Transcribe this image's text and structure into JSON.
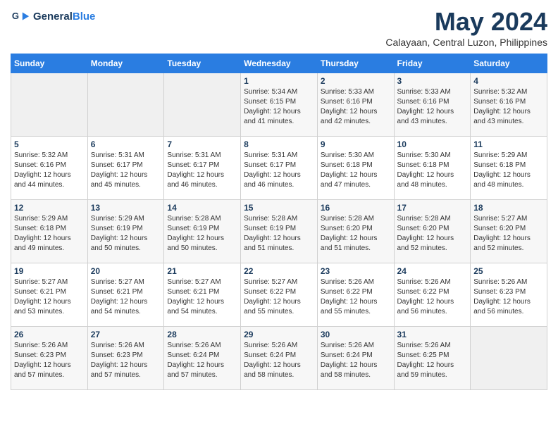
{
  "header": {
    "logo_line1": "General",
    "logo_line2": "Blue",
    "month_title": "May 2024",
    "location": "Calayaan, Central Luzon, Philippines"
  },
  "weekdays": [
    "Sunday",
    "Monday",
    "Tuesday",
    "Wednesday",
    "Thursday",
    "Friday",
    "Saturday"
  ],
  "weeks": [
    [
      {
        "day": "",
        "info": ""
      },
      {
        "day": "",
        "info": ""
      },
      {
        "day": "",
        "info": ""
      },
      {
        "day": "1",
        "info": "Sunrise: 5:34 AM\nSunset: 6:15 PM\nDaylight: 12 hours\nand 41 minutes."
      },
      {
        "day": "2",
        "info": "Sunrise: 5:33 AM\nSunset: 6:16 PM\nDaylight: 12 hours\nand 42 minutes."
      },
      {
        "day": "3",
        "info": "Sunrise: 5:33 AM\nSunset: 6:16 PM\nDaylight: 12 hours\nand 43 minutes."
      },
      {
        "day": "4",
        "info": "Sunrise: 5:32 AM\nSunset: 6:16 PM\nDaylight: 12 hours\nand 43 minutes."
      }
    ],
    [
      {
        "day": "5",
        "info": "Sunrise: 5:32 AM\nSunset: 6:16 PM\nDaylight: 12 hours\nand 44 minutes."
      },
      {
        "day": "6",
        "info": "Sunrise: 5:31 AM\nSunset: 6:17 PM\nDaylight: 12 hours\nand 45 minutes."
      },
      {
        "day": "7",
        "info": "Sunrise: 5:31 AM\nSunset: 6:17 PM\nDaylight: 12 hours\nand 46 minutes."
      },
      {
        "day": "8",
        "info": "Sunrise: 5:31 AM\nSunset: 6:17 PM\nDaylight: 12 hours\nand 46 minutes."
      },
      {
        "day": "9",
        "info": "Sunrise: 5:30 AM\nSunset: 6:18 PM\nDaylight: 12 hours\nand 47 minutes."
      },
      {
        "day": "10",
        "info": "Sunrise: 5:30 AM\nSunset: 6:18 PM\nDaylight: 12 hours\nand 48 minutes."
      },
      {
        "day": "11",
        "info": "Sunrise: 5:29 AM\nSunset: 6:18 PM\nDaylight: 12 hours\nand 48 minutes."
      }
    ],
    [
      {
        "day": "12",
        "info": "Sunrise: 5:29 AM\nSunset: 6:18 PM\nDaylight: 12 hours\nand 49 minutes."
      },
      {
        "day": "13",
        "info": "Sunrise: 5:29 AM\nSunset: 6:19 PM\nDaylight: 12 hours\nand 50 minutes."
      },
      {
        "day": "14",
        "info": "Sunrise: 5:28 AM\nSunset: 6:19 PM\nDaylight: 12 hours\nand 50 minutes."
      },
      {
        "day": "15",
        "info": "Sunrise: 5:28 AM\nSunset: 6:19 PM\nDaylight: 12 hours\nand 51 minutes."
      },
      {
        "day": "16",
        "info": "Sunrise: 5:28 AM\nSunset: 6:20 PM\nDaylight: 12 hours\nand 51 minutes."
      },
      {
        "day": "17",
        "info": "Sunrise: 5:28 AM\nSunset: 6:20 PM\nDaylight: 12 hours\nand 52 minutes."
      },
      {
        "day": "18",
        "info": "Sunrise: 5:27 AM\nSunset: 6:20 PM\nDaylight: 12 hours\nand 52 minutes."
      }
    ],
    [
      {
        "day": "19",
        "info": "Sunrise: 5:27 AM\nSunset: 6:21 PM\nDaylight: 12 hours\nand 53 minutes."
      },
      {
        "day": "20",
        "info": "Sunrise: 5:27 AM\nSunset: 6:21 PM\nDaylight: 12 hours\nand 54 minutes."
      },
      {
        "day": "21",
        "info": "Sunrise: 5:27 AM\nSunset: 6:21 PM\nDaylight: 12 hours\nand 54 minutes."
      },
      {
        "day": "22",
        "info": "Sunrise: 5:27 AM\nSunset: 6:22 PM\nDaylight: 12 hours\nand 55 minutes."
      },
      {
        "day": "23",
        "info": "Sunrise: 5:26 AM\nSunset: 6:22 PM\nDaylight: 12 hours\nand 55 minutes."
      },
      {
        "day": "24",
        "info": "Sunrise: 5:26 AM\nSunset: 6:22 PM\nDaylight: 12 hours\nand 56 minutes."
      },
      {
        "day": "25",
        "info": "Sunrise: 5:26 AM\nSunset: 6:23 PM\nDaylight: 12 hours\nand 56 minutes."
      }
    ],
    [
      {
        "day": "26",
        "info": "Sunrise: 5:26 AM\nSunset: 6:23 PM\nDaylight: 12 hours\nand 57 minutes."
      },
      {
        "day": "27",
        "info": "Sunrise: 5:26 AM\nSunset: 6:23 PM\nDaylight: 12 hours\nand 57 minutes."
      },
      {
        "day": "28",
        "info": "Sunrise: 5:26 AM\nSunset: 6:24 PM\nDaylight: 12 hours\nand 57 minutes."
      },
      {
        "day": "29",
        "info": "Sunrise: 5:26 AM\nSunset: 6:24 PM\nDaylight: 12 hours\nand 58 minutes."
      },
      {
        "day": "30",
        "info": "Sunrise: 5:26 AM\nSunset: 6:24 PM\nDaylight: 12 hours\nand 58 minutes."
      },
      {
        "day": "31",
        "info": "Sunrise: 5:26 AM\nSunset: 6:25 PM\nDaylight: 12 hours\nand 59 minutes."
      },
      {
        "day": "",
        "info": ""
      }
    ]
  ]
}
